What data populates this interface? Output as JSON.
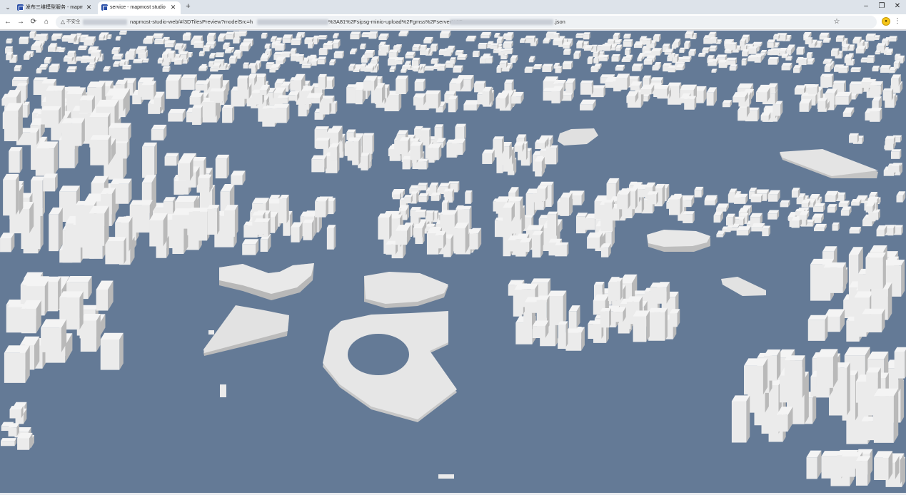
{
  "browser": {
    "tabs": [
      {
        "title": "发布三维模型服务 - mapmost",
        "active": false
      },
      {
        "title": "service - mapmost studio",
        "active": true
      }
    ],
    "address_bar": {
      "security_label": "不安全",
      "url_visible_parts": [
        "napmost-studio-web/#/3DTilesPreview?modelSrc=h",
        "%3A81%2Fsipsg-minio-upload%2Fgmss%2Fserver%2F",
        ".json"
      ]
    },
    "icons": {
      "tab_search": "chevron-down-icon",
      "new_tab": "plus-icon",
      "back": "arrow-left-icon",
      "forward": "arrow-right-icon",
      "reload": "reload-icon",
      "home": "home-icon",
      "security": "warning-triangle-icon",
      "bookmark": "star-icon",
      "extension": "extension-icon",
      "menu": "kebab-menu-icon"
    }
  },
  "viewer": {
    "background_color": "#647a96",
    "building_color": "#ebebeb",
    "building_shade_color": "#b9b9b9"
  }
}
